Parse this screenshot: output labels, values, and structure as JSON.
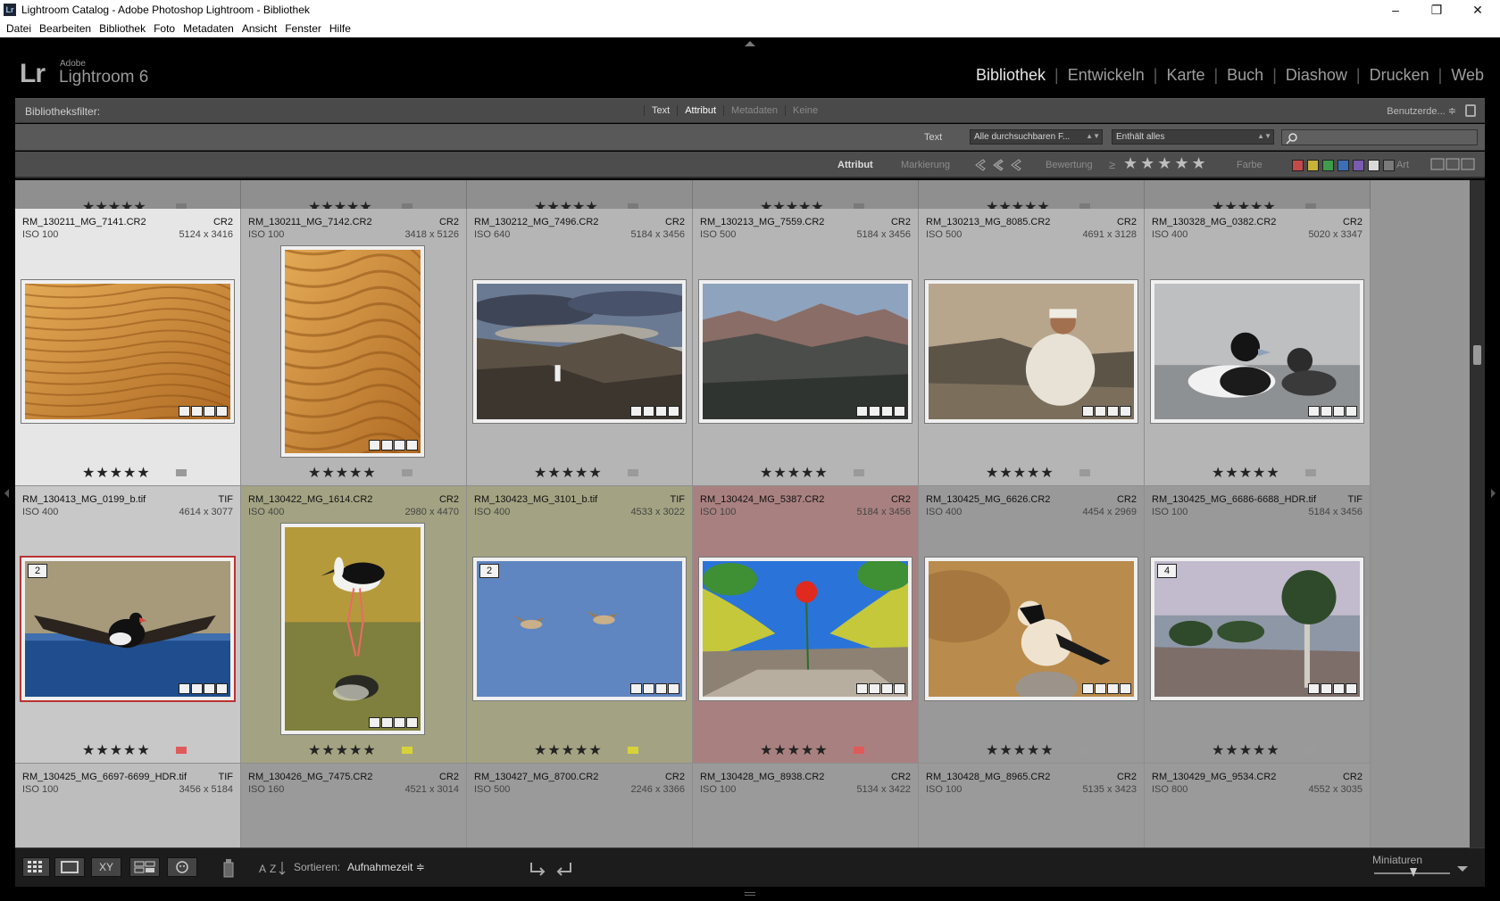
{
  "window": {
    "title": "Lightroom Catalog - Adobe Photoshop Lightroom - Bibliothek",
    "app_icon": "Lr",
    "controls": [
      "–",
      "❐",
      "✕"
    ]
  },
  "menu": [
    "Datei",
    "Bearbeiten",
    "Bibliothek",
    "Foto",
    "Metadaten",
    "Ansicht",
    "Fenster",
    "Hilfe"
  ],
  "identity": {
    "logo": "Lr",
    "brand_small": "Adobe",
    "brand_big": "Lightroom 6"
  },
  "modules": [
    "Bibliothek",
    "Entwickeln",
    "Karte",
    "Buch",
    "Diashow",
    "Drucken",
    "Web"
  ],
  "active_module": "Bibliothek",
  "filterbar": {
    "title": "Bibliotheksfilter:",
    "tabs": [
      {
        "label": "Text",
        "state": "on"
      },
      {
        "label": "Attribut",
        "state": "active"
      },
      {
        "label": "Metadaten",
        "state": "off"
      },
      {
        "label": "Keine",
        "state": "off"
      }
    ],
    "preset": "Benutzerde... ≑"
  },
  "text_filter": {
    "label": "Text",
    "field": "Alle durchsuchbaren F...",
    "rule": "Enthält alles",
    "search_placeholder": ""
  },
  "attribute_filter": {
    "label": "Attribut",
    "flag_label": "Markierung",
    "rating_label": "Bewertung",
    "rating_op": "≥",
    "rating_stars": "★★★★★",
    "color_label": "Farbe",
    "kind_label": "Art",
    "colors": [
      "#c44a4a",
      "#c8b23a",
      "#3e9b4a",
      "#3b6fb8",
      "#7a5bb0",
      "#d9d9d9",
      "#7a7a7a"
    ]
  },
  "grid": [
    {
      "name": "RM_130211_MG_7141.CR2",
      "type": "CR2",
      "iso": "ISO 100",
      "dims": "5124 x 3416",
      "stars": "★★★★★",
      "label": null,
      "stack": null,
      "orient": "land",
      "scene": "dune"
    },
    {
      "name": "RM_130211_MG_7142.CR2",
      "type": "CR2",
      "iso": "ISO 100",
      "dims": "3418 x 5126",
      "stars": "★★★★★",
      "label": null,
      "stack": null,
      "orient": "port",
      "scene": "dune"
    },
    {
      "name": "RM_130212_MG_7496.CR2",
      "type": "CR2",
      "iso": "ISO 640",
      "dims": "5184 x 3456",
      "stars": "★★★★★",
      "label": null,
      "stack": null,
      "orient": "land",
      "scene": "canyon"
    },
    {
      "name": "RM_130213_MG_7559.CR2",
      "type": "CR2",
      "iso": "ISO 500",
      "dims": "5184 x 3456",
      "stars": "★★★★★",
      "label": null,
      "stack": null,
      "orient": "land",
      "scene": "mountain"
    },
    {
      "name": "RM_130213_MG_8085.CR2",
      "type": "CR2",
      "iso": "ISO 500",
      "dims": "4691 x 3128",
      "stars": "★★★★★",
      "label": null,
      "stack": null,
      "orient": "land",
      "scene": "man"
    },
    {
      "name": "RM_130328_MG_0382.CR2",
      "type": "CR2",
      "iso": "ISO 400",
      "dims": "5020 x 3347",
      "stars": "★★★★★",
      "label": null,
      "stack": null,
      "orient": "land",
      "scene": "duck"
    },
    {
      "name": "RM_130413_MG_0199_b.tif",
      "type": "TIF",
      "iso": "ISO 400",
      "dims": "4614 x 3077",
      "stars": "★★★★★",
      "label": "red",
      "stack": "2",
      "orient": "land",
      "scene": "flight"
    },
    {
      "name": "RM_130422_MG_1614.CR2",
      "type": "CR2",
      "iso": "ISO 400",
      "dims": "2980 x 4470",
      "stars": "★★★★★",
      "label": "yellow",
      "stack": null,
      "orient": "port",
      "scene": "stilt"
    },
    {
      "name": "RM_130423_MG_3101_b.tif",
      "type": "TIF",
      "iso": "ISO 400",
      "dims": "4533 x 3022",
      "stars": "★★★★★",
      "label": "yellow",
      "stack": "2",
      "orient": "land",
      "scene": "sky"
    },
    {
      "name": "RM_130424_MG_5387.CR2",
      "type": "CR2",
      "iso": "ISO 100",
      "dims": "5184 x 3456",
      "stars": "★★★★★",
      "label": "red",
      "stack": null,
      "orient": "land",
      "scene": "poppy"
    },
    {
      "name": "RM_130425_MG_6626.CR2",
      "type": "CR2",
      "iso": "ISO 400",
      "dims": "4454 x 2969",
      "stars": "★★★★★",
      "label": null,
      "stack": null,
      "orient": "land",
      "scene": "wheatear"
    },
    {
      "name": "RM_130425_MG_6686-6688_HDR.tif",
      "type": "TIF",
      "iso": "ISO 100",
      "dims": "5184 x 3456",
      "stars": "★★★★★",
      "label": null,
      "stack": "4",
      "orient": "land",
      "scene": "tree"
    }
  ],
  "next_row": [
    {
      "name": "RM_130425_MG_6697-6699_HDR.tif",
      "type": "TIF",
      "iso": "ISO 100",
      "dims": "3456 x 5184"
    },
    {
      "name": "RM_130426_MG_7475.CR2",
      "type": "CR2",
      "iso": "ISO 160",
      "dims": "4521 x 3014"
    },
    {
      "name": "RM_130427_MG_8700.CR2",
      "type": "CR2",
      "iso": "ISO 500",
      "dims": "2246 x 3366"
    },
    {
      "name": "RM_130428_MG_8938.CR2",
      "type": "CR2",
      "iso": "ISO 100",
      "dims": "5134 x 3422"
    },
    {
      "name": "RM_130428_MG_8965.CR2",
      "type": "CR2",
      "iso": "ISO 100",
      "dims": "5135 x 3423"
    },
    {
      "name": "RM_130429_MG_9534.CR2",
      "type": "CR2",
      "iso": "ISO 800",
      "dims": "4552 x 3035"
    }
  ],
  "toolbar": {
    "sort_label": "Sortieren:",
    "sort_value": "Aufnahmezeit ≑",
    "thumbs_label": "Miniaturen",
    "view_buttons": [
      "grid-view-icon",
      "loupe-view-icon",
      "compare-view-icon",
      "survey-view-icon",
      "people-view-icon"
    ],
    "compare_text": "XY"
  },
  "label_colors": {
    "red": "#e05a5a",
    "yellow": "#d8d23a",
    "cell_red": "#a98080",
    "cell_yellow": "#a3a383",
    "cell_selected": "#e6e6e6"
  }
}
